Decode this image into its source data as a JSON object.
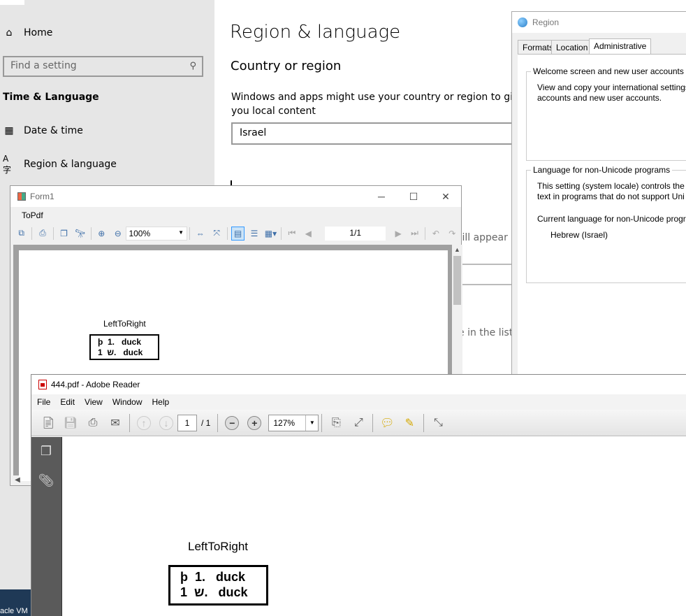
{
  "settings": {
    "sidebar": {
      "items": [
        {
          "label": "Home",
          "icon": "home-icon"
        },
        {
          "label": "Date & time",
          "icon": "calendar-clock-icon"
        },
        {
          "label": "Region & language",
          "icon": "language-icon"
        }
      ],
      "search_placeholder": "Find a setting",
      "section_heading": "Time & Language"
    },
    "page_title": "Region & language",
    "country_heading": "Country or region",
    "country_desc": "Windows and apps might use your country or region to give you local content",
    "country_value": "Israel",
    "fragment_appear": "will appear in",
    "fragment_list": "e in the list"
  },
  "region": {
    "title": "Region",
    "tabs": [
      "Formats",
      "Location",
      "Administrative"
    ],
    "welcome_title": "Welcome screen and new user accounts",
    "welcome_text_1": "View and copy your international settings",
    "welcome_text_2": "accounts and new user accounts.",
    "nonunicode_title": "Language for non-Unicode programs",
    "nonunicode_text_1": "This setting (system locale) controls the l",
    "nonunicode_text_2": "text in programs that do not support Uni",
    "current_label": "Current language for non-Unicode progr",
    "current_value": "Hebrew (Israel)"
  },
  "form1": {
    "title": "Form1",
    "menu": "ToPdf",
    "zoom": "100%",
    "page": "1/1",
    "preview": {
      "title": "LeftToRight",
      "line1": "þ  1.   duck",
      "line2": "1  ש.   duck"
    }
  },
  "reader": {
    "title": "444.pdf - Adobe Reader",
    "menu": [
      "File",
      "Edit",
      "View",
      "Window",
      "Help"
    ],
    "page_num": "1",
    "page_total": "/  1",
    "zoom": "127%",
    "doc": {
      "title": "LeftToRight",
      "line1": "þ  1.   duck",
      "line2": "1  ש.   duck"
    }
  },
  "taskbar": {
    "vm_label": "acle VM"
  }
}
